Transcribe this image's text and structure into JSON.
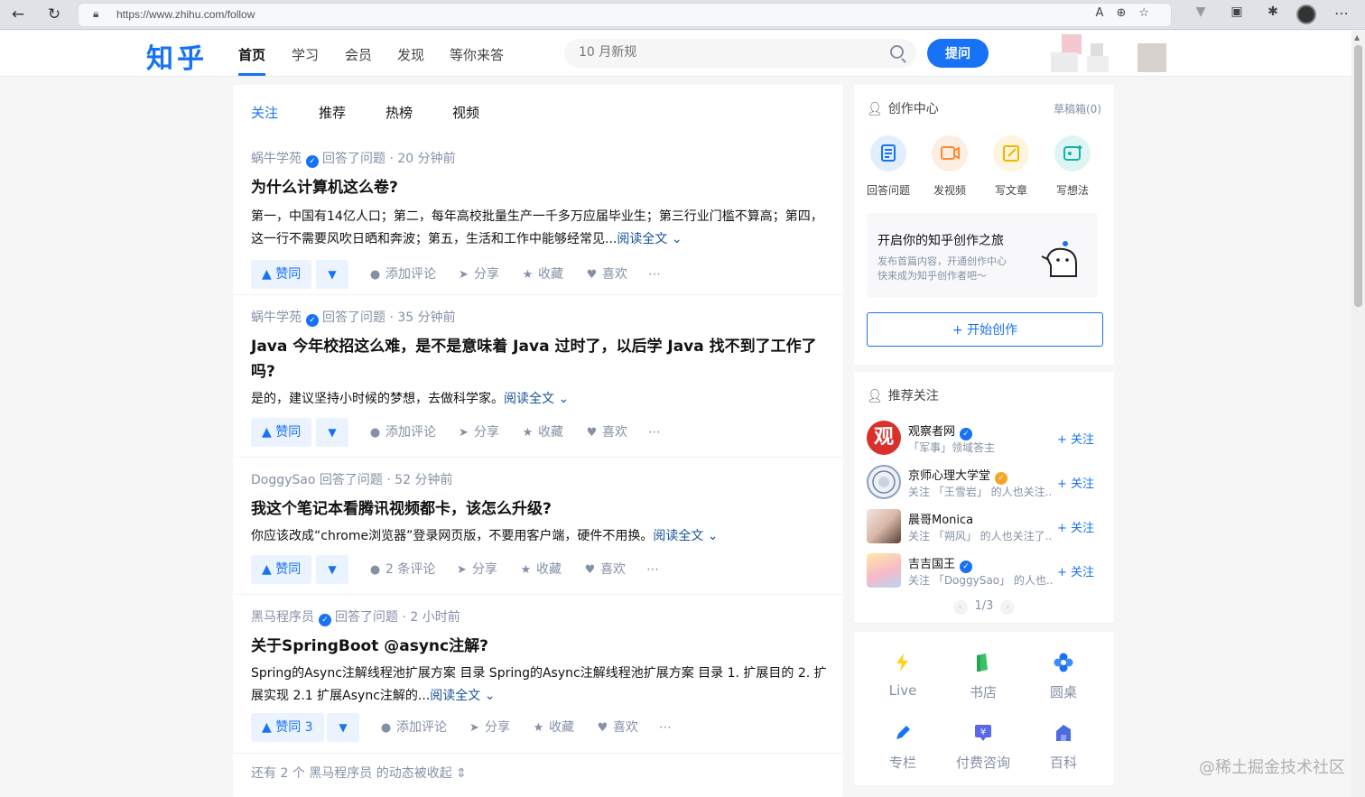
{
  "browser": {
    "url": "https://www.zhihu.com/follow"
  },
  "header": {
    "logo": "知乎",
    "nav": [
      "首页",
      "学习",
      "会员",
      "发现",
      "等你来答"
    ],
    "search_placeholder": "10 月新规",
    "ask_label": "提问"
  },
  "feed": {
    "tabs": [
      "关注",
      "推荐",
      "热榜",
      "视频"
    ],
    "items": [
      {
        "author": "蜗牛学苑",
        "verified": true,
        "meta": "回答了问题 · 20 分钟前",
        "title": "为什么计算机这么卷?",
        "excerpt": "第一，中国有14亿人口；第二，每年高校批量生产一千多万应届毕业生；第三行业门槛不算高；第四，这一行不需要风吹日晒和奔波；第五，生活和工作中能够经常见...",
        "read_more": "阅读全文",
        "vote": "赞同",
        "comment": "添加评论",
        "share": "分享",
        "collect": "收藏",
        "like": "喜欢"
      },
      {
        "author": "蜗牛学苑",
        "verified": true,
        "meta": "回答了问题 · 35 分钟前",
        "title": "Java 今年校招这么难，是不是意味着 Java 过时了，以后学 Java 找不到了工作了吗?",
        "excerpt": "是的，建议坚持小时候的梦想，去做科学家。",
        "read_more": "阅读全文",
        "vote": "赞同",
        "comment": "添加评论",
        "share": "分享",
        "collect": "收藏",
        "like": "喜欢"
      },
      {
        "author": "DoggySao",
        "verified": false,
        "meta": "回答了问题 · 52 分钟前",
        "title": "我这个笔记本看腾讯视频都卡，该怎么升级?",
        "excerpt": "你应该改成“chrome浏览器”登录网页版，不要用客户端，硬件不用换。",
        "read_more": "阅读全文",
        "vote": "赞同",
        "comment": "2 条评论",
        "share": "分享",
        "collect": "收藏",
        "like": "喜欢"
      },
      {
        "author": "黑马程序员",
        "verified": true,
        "meta": "回答了问题 · 2 小时前",
        "title": "关于SpringBoot @async注解?",
        "excerpt": "Spring的Async注解线程池扩展方案 目录 Spring的Async注解线程池扩展方案 目录 1. 扩展目的 2. 扩展实现 2.1 扩展Async注解的...",
        "read_more": "阅读全文",
        "vote": "赞同 3",
        "comment": "添加评论",
        "share": "分享",
        "collect": "收藏",
        "like": "喜欢"
      }
    ],
    "collapsed_note": "还有 2 个 黑马程序员 的动态被收起"
  },
  "creator": {
    "title": "创作中心",
    "drafts": "草稿箱(0)",
    "actions": [
      "回答问题",
      "发视频",
      "写文章",
      "写想法"
    ],
    "promo_title": "开启你的知乎创作之旅",
    "promo_desc_1": "发布首篇内容，开通创作中心",
    "promo_desc_2": "快来成为知乎创作者吧～",
    "start_label": "+ 开始创作"
  },
  "recommend": {
    "title": "推荐关注",
    "follow_label": "+ 关注",
    "users": [
      {
        "name": "观察者网",
        "desc": "「军事」领域答主"
      },
      {
        "name": "京师心理大学堂",
        "desc": "关注 「王雪岩」 的人也关注..."
      },
      {
        "name": "晨哥Monica",
        "desc": "关注 「朔风」 的人也关注了..."
      },
      {
        "name": "吉吉国王",
        "desc": "关注 「DoggySao」 的人也..."
      }
    ],
    "pager": "1/3"
  },
  "tools": [
    "Live",
    "书店",
    "圆桌",
    "专栏",
    "付费咨询",
    "百科"
  ],
  "watermark": "@稀土掘金技术社区",
  "colors": {
    "brand": "#1772f6",
    "link": "#175199",
    "muted": "#8590a6"
  }
}
